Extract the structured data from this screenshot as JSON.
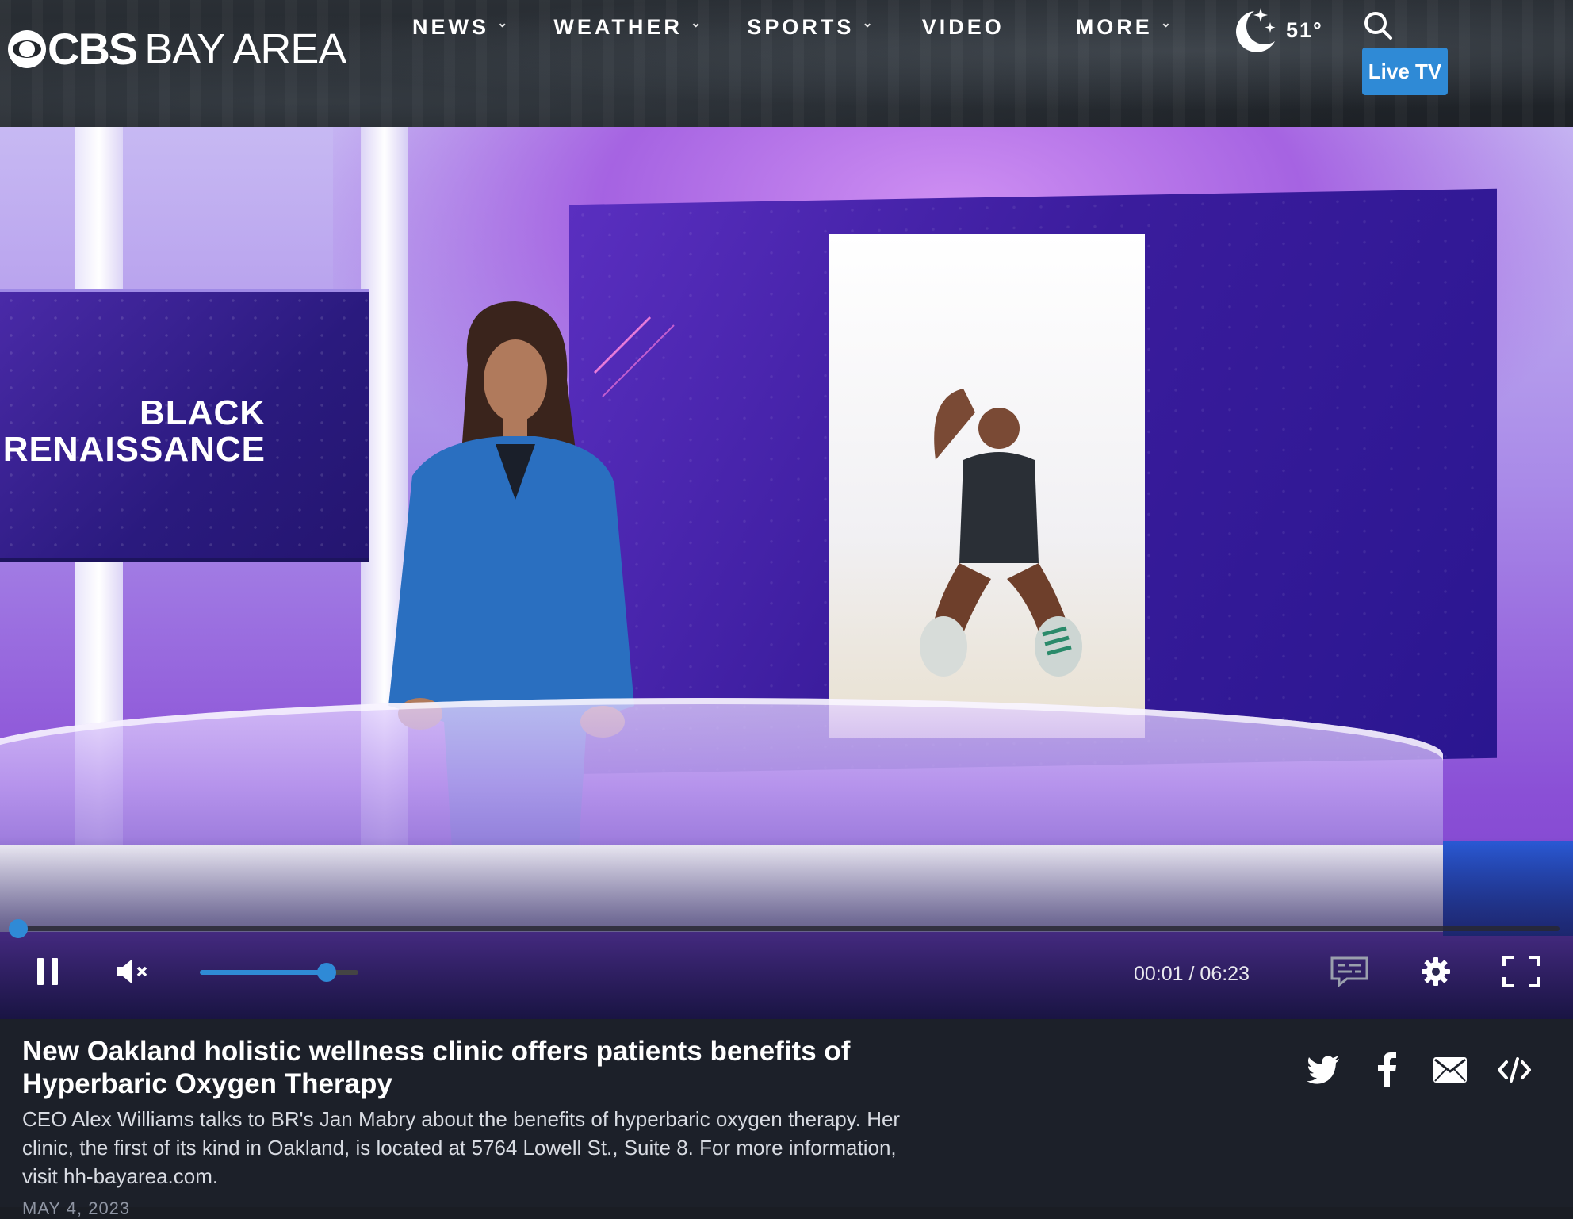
{
  "brand": {
    "logo_bold": "CBS",
    "logo_light": "BAY AREA"
  },
  "nav": {
    "items": [
      {
        "label": "NEWS",
        "has_dropdown": true
      },
      {
        "label": "WEATHER",
        "has_dropdown": true
      },
      {
        "label": "SPORTS",
        "has_dropdown": true
      },
      {
        "label": "VIDEO",
        "has_dropdown": false
      },
      {
        "label": "MORE",
        "has_dropdown": true
      }
    ],
    "weather_temp": "51°",
    "weather_icon": "moon-stars-icon",
    "live_tv_label": "Live TV"
  },
  "video": {
    "on_screen_graphic": {
      "line1": "BLACK",
      "line2": "RENAISSANCE"
    },
    "current_time": "00:01",
    "duration": "06:23",
    "progress_fraction": 0.003,
    "volume_fraction": 0.8,
    "muted": true,
    "controls": [
      "pause-icon",
      "mute-icon",
      "captions-icon",
      "settings-icon",
      "fullscreen-icon"
    ]
  },
  "article": {
    "title": "New Oakland holistic wellness clinic offers patients benefits of Hyperbaric Oxygen Therapy",
    "description": "CEO Alex Williams talks to BR's Jan Mabry about the benefits of hyperbaric oxygen therapy. Her clinic, the first of its kind in Oakland, is located at 5764 Lowell St., Suite 8. For more information, visit hh-bayarea.com.",
    "date": "MAY 4, 2023"
  },
  "share": [
    "twitter-icon",
    "facebook-icon",
    "email-icon",
    "embed-icon"
  ],
  "colors": {
    "accent": "#2f8ad6",
    "header_bg": "#22262b",
    "info_bg": "#1c2029"
  }
}
